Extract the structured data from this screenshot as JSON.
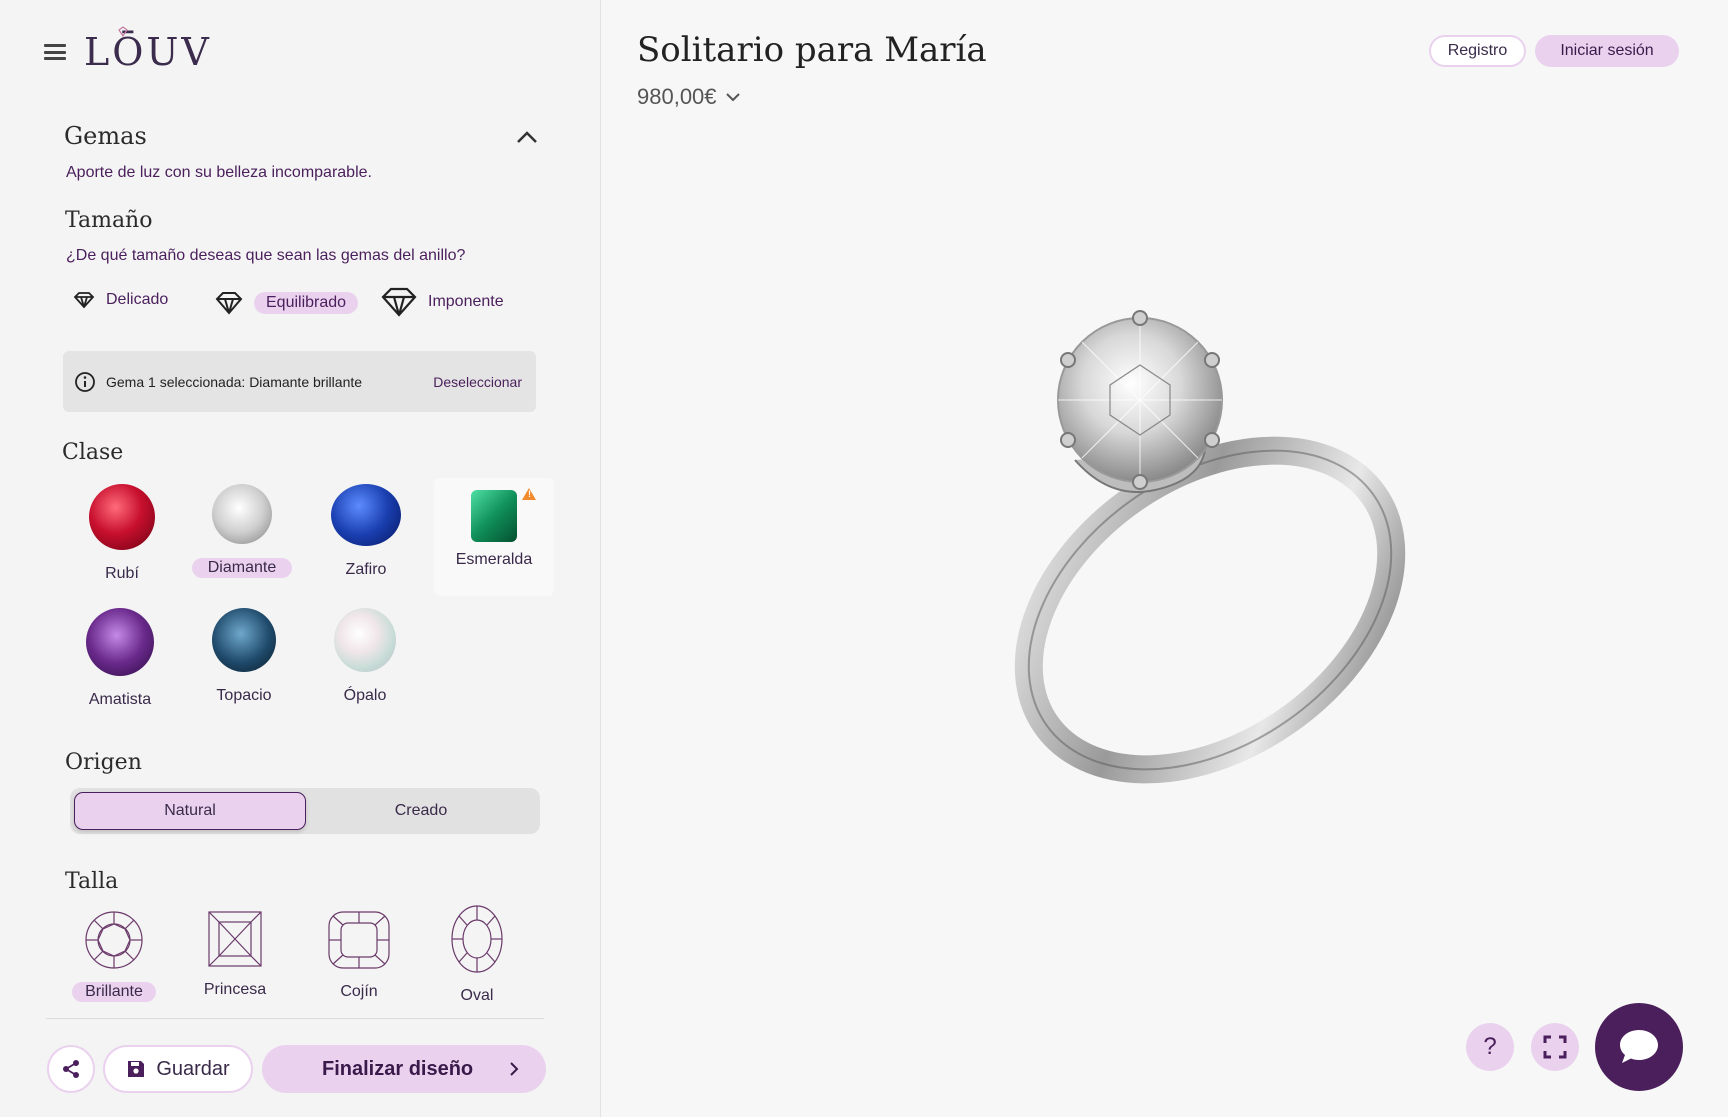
{
  "brand": {
    "logo_text": "LŌUV"
  },
  "panel": {
    "section_title": "Gemas",
    "section_subtitle": "Aporte de luz con su belleza incomparable.",
    "size": {
      "title": "Tamaño",
      "question": "¿De qué tamaño deseas que sean las gemas del anillo?",
      "options": [
        {
          "label": "Delicado",
          "selected": false
        },
        {
          "label": "Equilibrado",
          "selected": true
        },
        {
          "label": "Imponente",
          "selected": false
        }
      ]
    },
    "info": {
      "text": "Gema 1 seleccionada: Diamante brillante",
      "action": "Deseleccionar"
    },
    "class": {
      "title": "Clase",
      "gems": [
        {
          "label": "Rubí",
          "selected": false,
          "color": "#c8102e"
        },
        {
          "label": "Diamante",
          "selected": true,
          "color": "#d9d9d9"
        },
        {
          "label": "Zafiro",
          "selected": false,
          "color": "#1a3fb0"
        },
        {
          "label": "Esmeralda",
          "selected": false,
          "color": "#10905a",
          "warning": true
        },
        {
          "label": "Amatista",
          "selected": false,
          "color": "#6a2a8c"
        },
        {
          "label": "Topacio",
          "selected": false,
          "color": "#1f4a6b"
        },
        {
          "label": "Ópalo",
          "selected": false,
          "color": "#dcdcdc"
        }
      ]
    },
    "origin": {
      "title": "Origen",
      "options": [
        {
          "label": "Natural",
          "selected": true
        },
        {
          "label": "Creado",
          "selected": false
        }
      ]
    },
    "cut": {
      "title": "Talla",
      "options": [
        {
          "label": "Brillante",
          "selected": true
        },
        {
          "label": "Princesa",
          "selected": false
        },
        {
          "label": "Cojín",
          "selected": false
        },
        {
          "label": "Oval",
          "selected": false
        }
      ]
    },
    "footer": {
      "save_label": "Guardar",
      "finish_label": "Finalizar diseño"
    }
  },
  "header": {
    "title": "Solitario para María",
    "price": "980,00€",
    "register_label": "Registro",
    "login_label": "Iniciar sesión"
  },
  "controls": {
    "help_label": "?"
  },
  "colors": {
    "accent": "#ead2ef",
    "brand_purple": "#4a1f5c",
    "warning": "#f08a2c"
  }
}
